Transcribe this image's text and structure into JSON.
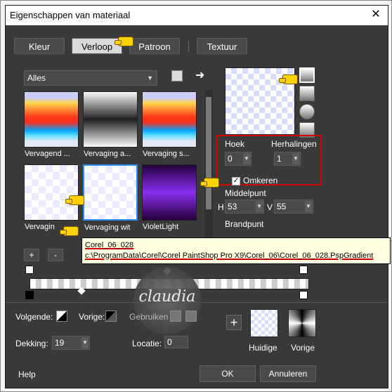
{
  "window": {
    "title": "Eigenschappen van materiaal",
    "close": "✕"
  },
  "tabs": [
    "Kleur",
    "Verloop",
    "Patroon",
    "Textuur"
  ],
  "filter": {
    "value": "Alles"
  },
  "gradients": [
    {
      "label": "Vervagend ..."
    },
    {
      "label": "Vervaging a..."
    },
    {
      "label": "Vervaging s..."
    },
    {
      "label": "Vervagin"
    },
    {
      "label": "Vervaging wit"
    },
    {
      "label": "VioletLight"
    }
  ],
  "settings": {
    "hoek_label": "Hoek",
    "hoek_value": "0",
    "herhalingen_label": "Herhalingen",
    "herhalingen_value": "1",
    "omkeren_label": "Omkeren",
    "middelpunt_label": "Middelpunt",
    "h_label": "H",
    "h_value": "53",
    "v_label": "V",
    "v_value": "55",
    "brandpunt_label": "Brandpunt"
  },
  "tooltip": {
    "name": "Corel_06_028",
    "path": "c:\\ProgramData\\Corel\\Corel PaintShop Pro X9\\Corel_06\\Corel_06_028.PspGradient"
  },
  "editor": {
    "plus": "+",
    "minus": "-"
  },
  "bottom": {
    "volgende_label": "Volgende:",
    "vorige_label": "Vorige:",
    "gebruiken_label": "Gebruiken",
    "dekking_label": "Dekking:",
    "dekking_value": "19",
    "locatie_label": "Locatie:",
    "locatie_value": "0",
    "huidige_label": "Huidige",
    "vorige2_label": "Vorige",
    "plus": "+"
  },
  "buttons": {
    "help": "Help",
    "ok": "OK",
    "cancel": "Annuleren"
  },
  "watermark": {
    "text": "claudia"
  }
}
